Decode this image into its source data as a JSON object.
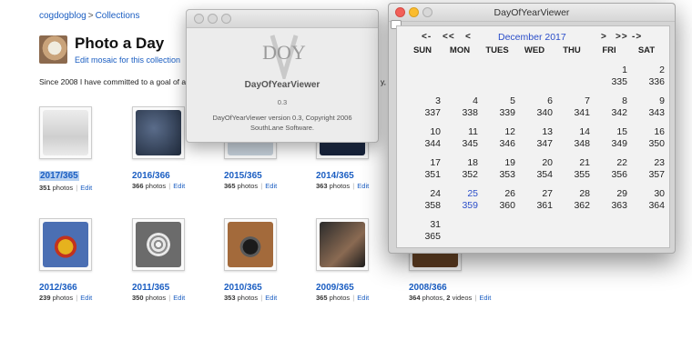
{
  "breadcrumb": {
    "user": "cogdogblog",
    "separator": ">",
    "section": "Collections"
  },
  "page": {
    "title": "Photo a Day",
    "edit_mosaic": "Edit mosaic for this collection",
    "intro": "Since 2008 I have committed to a goal of a da",
    "intro_tail": "y, t"
  },
  "collections": [
    {
      "title": "2017/365",
      "count": "351",
      "unit": "photos",
      "edit": "Edit",
      "selected": true
    },
    {
      "title": "2016/366",
      "count": "366",
      "unit": "photos",
      "edit": "Edit"
    },
    {
      "title": "2015/365",
      "count": "365",
      "unit": "photos",
      "edit": "Edit"
    },
    {
      "title": "2014/365",
      "count": "363",
      "unit": "photos",
      "edit": "Edit"
    },
    {
      "title": "2012/366",
      "count": "239",
      "unit": "photos",
      "edit": "Edit"
    },
    {
      "title": "2011/365",
      "count": "350",
      "unit": "photos",
      "edit": "Edit"
    },
    {
      "title": "2010/365",
      "count": "353",
      "unit": "photos",
      "edit": "Edit"
    },
    {
      "title": "2009/365",
      "count": "365",
      "unit": "photos",
      "edit": "Edit"
    },
    {
      "title": "2008/366",
      "count": "364",
      "unit": "photos, ",
      "count2": "2",
      "unit2": "videos",
      "edit": "Edit"
    }
  ],
  "about_window": {
    "logo_text": "DOY",
    "logo_letter": "V",
    "app_name": "DayOfYearViewer",
    "version": "0.3",
    "copyright_line1": "DayOfYearViewer version 0.3, Copyright 2006",
    "copyright_line2": "SouthLane Software."
  },
  "calendar_window": {
    "title": "DayOfYearViewer",
    "nav": {
      "prev_year": "<-",
      "prev_prev": "<<",
      "prev_month": "<",
      "next_month": ">",
      "next_next": ">>",
      "next_year": "->"
    },
    "month_label": "December 2017",
    "weekdays": [
      "SUN",
      "MON",
      "TUES",
      "WED",
      "THU",
      "FRI",
      "SAT"
    ],
    "today": 25,
    "first_weekday": 5,
    "days": [
      [
        "1",
        "335"
      ],
      [
        "2",
        "336"
      ],
      [
        "3",
        "337"
      ],
      [
        "4",
        "338"
      ],
      [
        "5",
        "339"
      ],
      [
        "6",
        "340"
      ],
      [
        "7",
        "341"
      ],
      [
        "8",
        "342"
      ],
      [
        "9",
        "343"
      ],
      [
        "10",
        "344"
      ],
      [
        "11",
        "345"
      ],
      [
        "12",
        "346"
      ],
      [
        "13",
        "347"
      ],
      [
        "14",
        "348"
      ],
      [
        "15",
        "349"
      ],
      [
        "16",
        "350"
      ],
      [
        "17",
        "351"
      ],
      [
        "18",
        "352"
      ],
      [
        "19",
        "353"
      ],
      [
        "20",
        "354"
      ],
      [
        "21",
        "355"
      ],
      [
        "22",
        "356"
      ],
      [
        "23",
        "357"
      ],
      [
        "24",
        "358"
      ],
      [
        "25",
        "359"
      ],
      [
        "26",
        "360"
      ],
      [
        "27",
        "361"
      ],
      [
        "28",
        "362"
      ],
      [
        "29",
        "363"
      ],
      [
        "30",
        "364"
      ],
      [
        "31",
        "365"
      ]
    ]
  },
  "colors": {
    "link": "#1b5ec2",
    "today": "#2b4ec9",
    "selection": "#b7d0f0"
  },
  "icons": {
    "window_close": "close-icon",
    "window_minimize": "minimize-icon",
    "window_zoom": "zoom-icon"
  }
}
